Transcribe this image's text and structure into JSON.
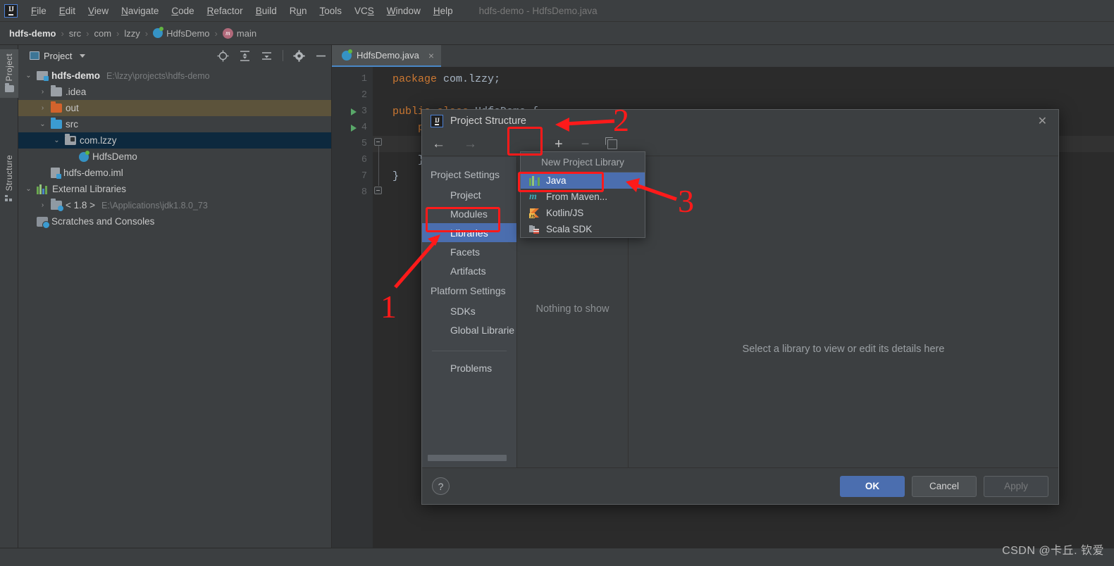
{
  "menubar": {
    "logo": "IJ",
    "items": [
      "File",
      "Edit",
      "View",
      "Navigate",
      "Code",
      "Refactor",
      "Build",
      "Run",
      "Tools",
      "VCS",
      "Window",
      "Help"
    ],
    "window_title": "hdfs-demo - HdfsDemo.java"
  },
  "breadcrumb": {
    "items": [
      "hdfs-demo",
      "src",
      "com",
      "lzzy",
      "HdfsDemo",
      "main"
    ],
    "separator": "›"
  },
  "toolstrip": {
    "project_tab": "Project",
    "structure_tab": "Structure"
  },
  "project_panel": {
    "title": "Project",
    "tools": [
      "locate-icon",
      "expand-all-icon",
      "collapse-all-icon",
      "settings-gear-icon",
      "hide-icon"
    ],
    "tree": [
      {
        "label": "hdfs-demo",
        "sub": "E:\\lzzy\\projects\\hdfs-demo",
        "arrow": "⌄",
        "depth": 0,
        "icon": "module",
        "bold": true,
        "state": "normal"
      },
      {
        "label": ".idea",
        "sub": "",
        "arrow": "›",
        "depth": 1,
        "icon": "gray",
        "bold": false,
        "state": "normal"
      },
      {
        "label": "out",
        "sub": "",
        "arrow": "›",
        "depth": 1,
        "icon": "orange",
        "bold": false,
        "state": "sel-out"
      },
      {
        "label": "src",
        "sub": "",
        "arrow": "⌄",
        "depth": 1,
        "icon": "blue",
        "bold": false,
        "state": "normal"
      },
      {
        "label": "com.lzzy",
        "sub": "",
        "arrow": "⌄",
        "depth": 2,
        "icon": "pkg",
        "bold": false,
        "state": "sel-focus"
      },
      {
        "label": "HdfsDemo",
        "sub": "",
        "arrow": "",
        "depth": 3,
        "icon": "class",
        "bold": false,
        "state": "normal"
      },
      {
        "label": "hdfs-demo.iml",
        "sub": "",
        "arrow": "",
        "depth": 1,
        "icon": "iml",
        "bold": false,
        "state": "normal"
      },
      {
        "label": "External Libraries",
        "sub": "",
        "arrow": "⌄",
        "depth": 0,
        "icon": "extlib",
        "bold": false,
        "state": "normal"
      },
      {
        "label": "< 1.8 >",
        "sub": "E:\\Applications\\jdk1.8.0_73",
        "arrow": "›",
        "depth": 1,
        "icon": "jdk",
        "bold": false,
        "state": "normal"
      },
      {
        "label": "Scratches and Consoles",
        "sub": "",
        "arrow": "",
        "depth": 0,
        "icon": "scratch",
        "bold": false,
        "state": "normal"
      }
    ]
  },
  "editor": {
    "tab_label": "HdfsDemo.java",
    "tab_close": "×",
    "lines": [
      {
        "n": "1",
        "text": "package com.lzzy;",
        "run": false
      },
      {
        "n": "2",
        "text": "",
        "run": false
      },
      {
        "n": "3",
        "text": "public class HdfsDemo {",
        "run": true
      },
      {
        "n": "4",
        "text": "    public static void main(S",
        "run": true
      },
      {
        "n": "5",
        "text": "",
        "run": false
      },
      {
        "n": "6",
        "text": "    }",
        "run": false
      },
      {
        "n": "7",
        "text": "}",
        "run": false
      },
      {
        "n": "8",
        "text": "",
        "run": false
      }
    ]
  },
  "dialog": {
    "title": "Project Structure",
    "logo": "IJ",
    "close_label": "✕",
    "toolbar": {
      "back": "←",
      "forward": "→",
      "add": "+",
      "remove": "−",
      "copy": "copy-icon"
    },
    "sidebar": {
      "group_project_settings": "Project Settings",
      "group_platform_settings": "Platform Settings",
      "project_items": [
        "Project",
        "Modules",
        "Libraries",
        "Facets",
        "Artifacts"
      ],
      "platform_items": [
        "SDKs",
        "Global Librarie"
      ],
      "other_items": [
        "Problems"
      ],
      "selected": "Libraries"
    },
    "middle_panel": {
      "empty_text": "Nothing to show"
    },
    "right_panel": {
      "hint": "Select a library to view or edit its details here"
    },
    "footer": {
      "help": "?",
      "ok": "OK",
      "cancel": "Cancel",
      "apply": "Apply"
    }
  },
  "popup": {
    "header": "New Project Library",
    "items": [
      {
        "label": "Java",
        "icon": "java-icon",
        "selected": true
      },
      {
        "label": "From Maven...",
        "icon": "maven-icon",
        "selected": false
      },
      {
        "label": "Kotlin/JS",
        "icon": "kotlin-js-icon",
        "selected": false
      },
      {
        "label": "Scala SDK",
        "icon": "scala-sdk-icon",
        "selected": false
      }
    ]
  },
  "annotations": {
    "color": "#ff1a1a",
    "markers": [
      {
        "number": "1",
        "target": "Libraries sidebar item"
      },
      {
        "number": "2",
        "target": "Add (+) toolbar button"
      },
      {
        "number": "3",
        "target": "Java popup menu item"
      }
    ]
  },
  "watermark": "CSDN @卡丘. 钦爱"
}
